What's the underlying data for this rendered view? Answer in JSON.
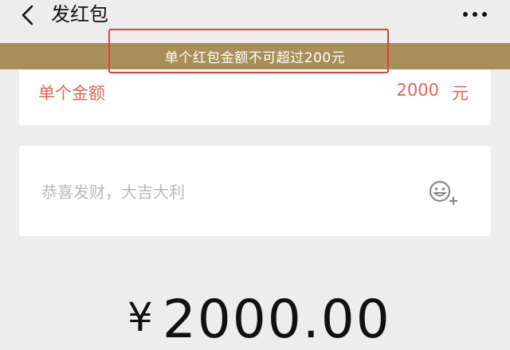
{
  "header": {
    "title": "发红包",
    "back_icon": "chevron-left-icon",
    "more_icon": "more-dots-icon"
  },
  "warning": {
    "text": "单个红包金额不可超过200元",
    "background_color": "#a88f58",
    "highlight_color": "#e23b3b"
  },
  "amount_field": {
    "label": "单个金额",
    "value": "2000",
    "unit": "元",
    "text_color": "#e0645a"
  },
  "greeting_field": {
    "placeholder": "恭喜发财，大吉大利",
    "emoji_icon": "emoji-add-icon"
  },
  "total": {
    "currency": "¥",
    "amount": "2000.00"
  }
}
